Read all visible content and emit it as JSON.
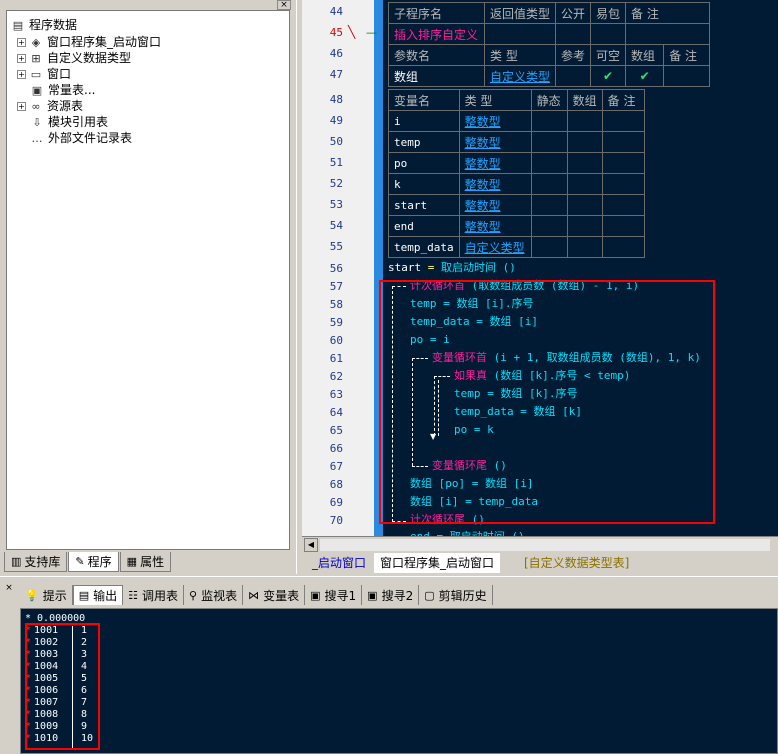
{
  "tree": {
    "root_label": "程序数据",
    "items": [
      {
        "label": "窗口程序集_启动窗口",
        "icon": "module-icon"
      },
      {
        "label": "自定义数据类型",
        "icon": "datatype-icon"
      },
      {
        "label": "窗口",
        "icon": "window-icon"
      },
      {
        "label": "常量表...",
        "icon": "constant-icon"
      },
      {
        "label": "资源表",
        "icon": "resource-icon"
      },
      {
        "label": "模块引用表",
        "icon": "module-ref-icon"
      },
      {
        "label": "外部文件记录表",
        "icon": "file-record-icon"
      }
    ]
  },
  "left_tabs": [
    {
      "label": "支持库",
      "icon": "library-icon"
    },
    {
      "label": "程序",
      "icon": "program-icon"
    },
    {
      "label": "属性",
      "icon": "property-icon"
    }
  ],
  "line_numbers": [
    "44",
    "45",
    "46",
    "47",
    "48",
    "49",
    "50",
    "51",
    "52",
    "53",
    "54",
    "55",
    "56",
    "57",
    "58",
    "59",
    "60",
    "61",
    "62",
    "63",
    "64",
    "65",
    "66",
    "67",
    "68",
    "69",
    "70"
  ],
  "sub_table": {
    "headers": [
      "子程序名",
      "返回值类型",
      "公开",
      "易包",
      "备 注"
    ],
    "name": "插入排序自定义",
    "param_headers": [
      "参数名",
      "类 型",
      "参考",
      "可空",
      "数组",
      "备 注"
    ],
    "param": {
      "name": "数组",
      "type": "自定义类型",
      "nullable_check": "✔",
      "array_check": "✔"
    }
  },
  "var_table": {
    "headers": [
      "变量名",
      "类 型",
      "静态",
      "数组",
      "备 注"
    ],
    "rows": [
      {
        "name": "i",
        "type": "整数型"
      },
      {
        "name": "temp",
        "type": "整数型"
      },
      {
        "name": "po",
        "type": "整数型"
      },
      {
        "name": "k",
        "type": "整数型"
      },
      {
        "name": "start",
        "type": "整数型"
      },
      {
        "name": "end",
        "type": "整数型"
      },
      {
        "name": "temp_data",
        "type": "自定义类型"
      }
    ]
  },
  "code": {
    "l56": {
      "a": "start",
      "b": "=",
      "c": "取启动时间 ()"
    },
    "l57": {
      "kw": "计次循环首",
      "rest": "(取数组成员数 (数组) - 1, i)"
    },
    "l58": "temp = 数组 [i].序号",
    "l59": "temp_data = 数组 [i]",
    "l60": "po = i",
    "l61": {
      "kw": "变量循环首",
      "rest": "(i + 1, 取数组成员数 (数组), 1, k)"
    },
    "l62": {
      "kw": "如果真",
      "rest": "(数组 [k].序号 < temp)"
    },
    "l63": "temp = 数组 [k].序号",
    "l64": "temp_data = 数组 [k]",
    "l65": "po = k",
    "l67": {
      "kw": "变量循环尾",
      "rest": "()"
    },
    "l68": "数组 [po] = 数组 [i]",
    "l69": "数组 [i] = temp_data",
    "l70": {
      "kw": "计次循环尾",
      "rest": "()"
    },
    "l71": "end = 取启动时间 ()"
  },
  "editor_tabs": [
    "_启动窗口",
    "窗口程序集_启动窗口",
    "[自定义数据类型表]"
  ],
  "output_tabs": [
    {
      "label": "提示",
      "icon": "hint-icon"
    },
    {
      "label": "输出",
      "icon": "output-icon"
    },
    {
      "label": "调用表",
      "icon": "call-table-icon"
    },
    {
      "label": "监视表",
      "icon": "watch-icon"
    },
    {
      "label": "变量表",
      "icon": "variable-icon"
    },
    {
      "label": "搜寻1",
      "icon": "search1-icon"
    },
    {
      "label": "搜寻2",
      "icon": "search2-icon"
    },
    {
      "label": "剪辑历史",
      "icon": "clip-history-icon"
    }
  ],
  "output": {
    "first": "* 0.000000",
    "rows": [
      {
        "a": "1001",
        "b": "1"
      },
      {
        "a": "1002",
        "b": "2"
      },
      {
        "a": "1003",
        "b": "3"
      },
      {
        "a": "1004",
        "b": "4"
      },
      {
        "a": "1005",
        "b": "5"
      },
      {
        "a": "1006",
        "b": "6"
      },
      {
        "a": "1007",
        "b": "7"
      },
      {
        "a": "1008",
        "b": "8"
      },
      {
        "a": "1009",
        "b": "9"
      },
      {
        "a": "1010",
        "b": "10"
      }
    ]
  }
}
